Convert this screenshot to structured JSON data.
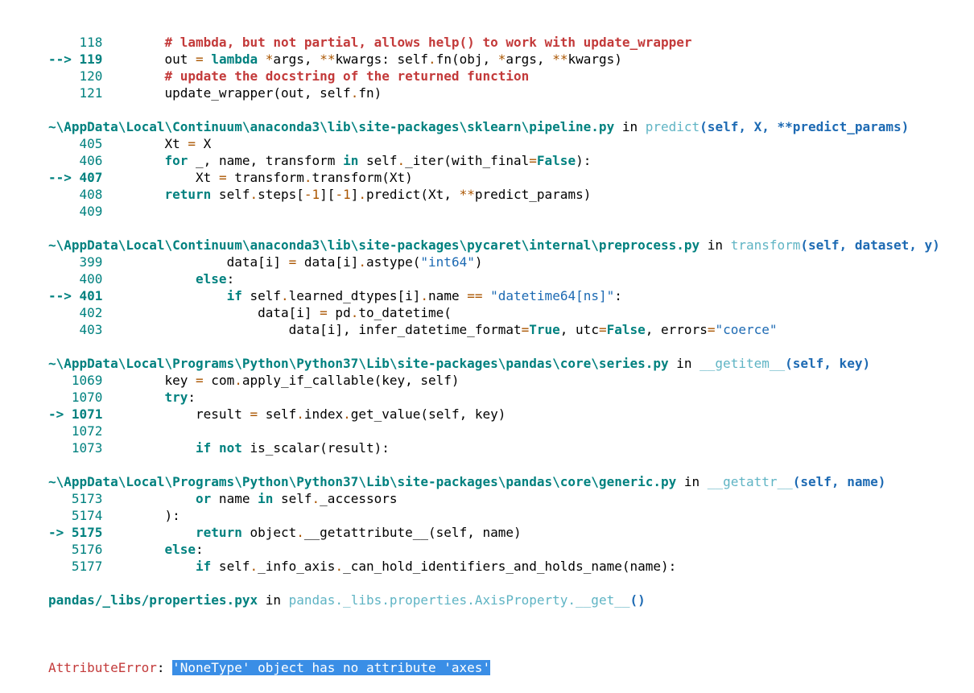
{
  "frames": [
    {
      "lines": [
        {
          "marker": "    ",
          "num": "118",
          "code": [
            [
              "        ",
              ""
            ],
            [
              "# lambda, but not partial, allows help() to work with update_wrapper",
              "cm"
            ]
          ]
        },
        {
          "marker": "--> ",
          "num": "119",
          "current": true,
          "code": [
            [
              "        out ",
              ""
            ],
            [
              "=",
              "op"
            ],
            [
              " ",
              ""
            ],
            [
              "lambda",
              "kw"
            ],
            [
              " ",
              ""
            ],
            [
              "*",
              "op"
            ],
            [
              "args",
              ""
            ],
            [
              ", ",
              ""
            ],
            [
              "**",
              "op"
            ],
            [
              "kwargs",
              ""
            ],
            [
              ": self",
              ""
            ],
            [
              ".",
              "op"
            ],
            [
              "fn(obj, ",
              ""
            ],
            [
              "*",
              "op"
            ],
            [
              "args, ",
              ""
            ],
            [
              "**",
              "op"
            ],
            [
              "kwargs)",
              ""
            ]
          ]
        },
        {
          "marker": "    ",
          "num": "120",
          "code": [
            [
              "        ",
              ""
            ],
            [
              "# update the docstring of the returned function",
              "cm"
            ]
          ]
        },
        {
          "marker": "    ",
          "num": "121",
          "code": [
            [
              "        update_wrapper(out, self",
              ""
            ],
            [
              ".",
              "op"
            ],
            [
              "fn)",
              ""
            ]
          ]
        }
      ]
    },
    {
      "header": {
        "path": "~\\AppData\\Local\\Continuum\\anaconda3\\lib\\site-packages\\sklearn\\pipeline.py",
        "in": " in ",
        "fn": "predict",
        "args": "(self, X, **predict_params)"
      },
      "lines": [
        {
          "marker": "    ",
          "num": "405",
          "code": [
            [
              "        Xt ",
              ""
            ],
            [
              "=",
              "op"
            ],
            [
              " X",
              ""
            ]
          ]
        },
        {
          "marker": "    ",
          "num": "406",
          "code": [
            [
              "        ",
              ""
            ],
            [
              "for",
              "kw"
            ],
            [
              " _, name, transform ",
              ""
            ],
            [
              "in",
              "kw"
            ],
            [
              " self",
              ""
            ],
            [
              ".",
              "op"
            ],
            [
              "_iter(with_final",
              ""
            ],
            [
              "=",
              "op"
            ],
            [
              "False",
              "kw"
            ],
            [
              "):",
              ""
            ]
          ]
        },
        {
          "marker": "--> ",
          "num": "407",
          "current": true,
          "code": [
            [
              "            Xt ",
              ""
            ],
            [
              "=",
              "op"
            ],
            [
              " transform",
              ""
            ],
            [
              ".",
              "op"
            ],
            [
              "transform(Xt)",
              ""
            ]
          ]
        },
        {
          "marker": "    ",
          "num": "408",
          "code": [
            [
              "        ",
              ""
            ],
            [
              "return",
              "kw"
            ],
            [
              " self",
              ""
            ],
            [
              ".",
              "op"
            ],
            [
              "steps[",
              ""
            ],
            [
              "-1",
              "op"
            ],
            [
              "][",
              ""
            ],
            [
              "-1",
              "op"
            ],
            [
              "]",
              ""
            ],
            [
              ".",
              "op"
            ],
            [
              "predict(Xt, ",
              ""
            ],
            [
              "**",
              "op"
            ],
            [
              "predict_params)",
              ""
            ]
          ]
        },
        {
          "marker": "    ",
          "num": "409",
          "code": []
        }
      ]
    },
    {
      "header": {
        "path": "~\\AppData\\Local\\Continuum\\anaconda3\\lib\\site-packages\\pycaret\\internal\\preprocess.py",
        "in": " in ",
        "fn": "transform",
        "args": "(self, dataset, y)"
      },
      "lines": [
        {
          "marker": "    ",
          "num": "399",
          "code": [
            [
              "                data[i] ",
              ""
            ],
            [
              "=",
              "op"
            ],
            [
              " data[i]",
              ""
            ],
            [
              ".",
              "op"
            ],
            [
              "astype(",
              ""
            ],
            [
              "\"int64\"",
              "str"
            ],
            [
              ")",
              ""
            ]
          ]
        },
        {
          "marker": "    ",
          "num": "400",
          "code": [
            [
              "            ",
              ""
            ],
            [
              "else",
              "kw"
            ],
            [
              ":",
              ""
            ]
          ]
        },
        {
          "marker": "--> ",
          "num": "401",
          "current": true,
          "code": [
            [
              "                ",
              ""
            ],
            [
              "if",
              "kw"
            ],
            [
              " self",
              ""
            ],
            [
              ".",
              "op"
            ],
            [
              "learned_dtypes[i]",
              ""
            ],
            [
              ".",
              "op"
            ],
            [
              "name ",
              ""
            ],
            [
              "==",
              "op"
            ],
            [
              " ",
              ""
            ],
            [
              "\"datetime64[ns]\"",
              "str"
            ],
            [
              ":",
              ""
            ]
          ]
        },
        {
          "marker": "    ",
          "num": "402",
          "code": [
            [
              "                    data[i] ",
              ""
            ],
            [
              "=",
              "op"
            ],
            [
              " pd",
              ""
            ],
            [
              ".",
              "op"
            ],
            [
              "to_datetime(",
              ""
            ]
          ]
        },
        {
          "marker": "    ",
          "num": "403",
          "code": [
            [
              "                        data[i], infer_datetime_format",
              ""
            ],
            [
              "=",
              "op"
            ],
            [
              "True",
              "kw"
            ],
            [
              ", utc",
              ""
            ],
            [
              "=",
              "op"
            ],
            [
              "False",
              "kw"
            ],
            [
              ", errors",
              ""
            ],
            [
              "=",
              "op"
            ],
            [
              "\"coerce\"",
              "str"
            ]
          ]
        }
      ]
    },
    {
      "header": {
        "path": "~\\AppData\\Local\\Programs\\Python\\Python37\\Lib\\site-packages\\pandas\\core\\series.py",
        "in": " in ",
        "fn": "__getitem__",
        "args": "(self, key)"
      },
      "lines": [
        {
          "marker": "   ",
          "num": "1069",
          "code": [
            [
              "        key ",
              ""
            ],
            [
              "=",
              "op"
            ],
            [
              " com",
              ""
            ],
            [
              ".",
              "op"
            ],
            [
              "apply_if_callable(key, self)",
              ""
            ]
          ]
        },
        {
          "marker": "   ",
          "num": "1070",
          "code": [
            [
              "        ",
              ""
            ],
            [
              "try",
              "kw"
            ],
            [
              ":",
              ""
            ]
          ]
        },
        {
          "marker": "-> ",
          "num": "1071",
          "current": true,
          "code": [
            [
              "            result ",
              ""
            ],
            [
              "=",
              "op"
            ],
            [
              " self",
              ""
            ],
            [
              ".",
              "op"
            ],
            [
              "index",
              ""
            ],
            [
              ".",
              "op"
            ],
            [
              "get_value(self, key)",
              ""
            ]
          ]
        },
        {
          "marker": "   ",
          "num": "1072",
          "code": []
        },
        {
          "marker": "   ",
          "num": "1073",
          "code": [
            [
              "            ",
              ""
            ],
            [
              "if",
              "kw"
            ],
            [
              " ",
              ""
            ],
            [
              "not",
              "kw"
            ],
            [
              " is_scalar(result):",
              ""
            ]
          ]
        }
      ]
    },
    {
      "header": {
        "path": "~\\AppData\\Local\\Programs\\Python\\Python37\\Lib\\site-packages\\pandas\\core\\generic.py",
        "in": " in ",
        "fn": "__getattr__",
        "args": "(self, name)"
      },
      "lines": [
        {
          "marker": "   ",
          "num": "5173",
          "code": [
            [
              "            ",
              ""
            ],
            [
              "or",
              "kw"
            ],
            [
              " name ",
              ""
            ],
            [
              "in",
              "kw"
            ],
            [
              " self",
              ""
            ],
            [
              ".",
              "op"
            ],
            [
              "_accessors",
              ""
            ]
          ]
        },
        {
          "marker": "   ",
          "num": "5174",
          "code": [
            [
              "        ):",
              ""
            ]
          ]
        },
        {
          "marker": "-> ",
          "num": "5175",
          "current": true,
          "code": [
            [
              "            ",
              ""
            ],
            [
              "return",
              "kw"
            ],
            [
              " object",
              ""
            ],
            [
              ".",
              "op"
            ],
            [
              "__getattribute__(self, name)",
              ""
            ]
          ]
        },
        {
          "marker": "   ",
          "num": "5176",
          "code": [
            [
              "        ",
              ""
            ],
            [
              "else",
              "kw"
            ],
            [
              ":",
              ""
            ]
          ]
        },
        {
          "marker": "   ",
          "num": "5177",
          "code": [
            [
              "            ",
              ""
            ],
            [
              "if",
              "kw"
            ],
            [
              " self",
              ""
            ],
            [
              ".",
              "op"
            ],
            [
              "_info_axis",
              ""
            ],
            [
              ".",
              "op"
            ],
            [
              "_can_hold_identifiers_and_holds_name(name):",
              ""
            ]
          ]
        }
      ]
    },
    {
      "header": {
        "path": "pandas/_libs/properties.pyx",
        "in": " in ",
        "fn": "pandas._libs.properties.AxisProperty.__get__",
        "args": "()"
      },
      "lines": []
    }
  ],
  "error": {
    "type": "AttributeError",
    "sep": ": ",
    "message": "'NoneType' object has no attribute 'axes'"
  }
}
